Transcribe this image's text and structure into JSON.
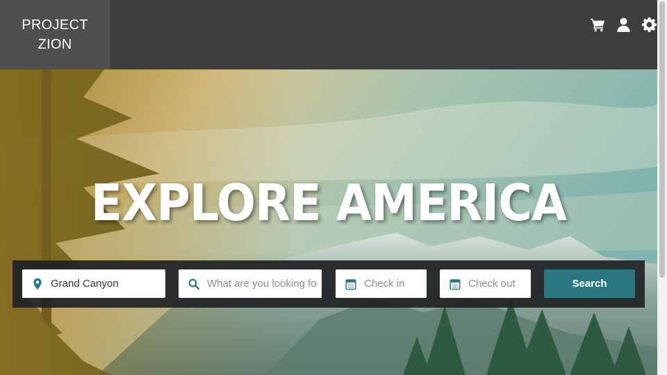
{
  "brand": {
    "line1": "PROJECT",
    "line2": "ZION"
  },
  "header_icons": [
    "cart-icon",
    "user-icon",
    "settings-icon"
  ],
  "hero": {
    "headline": "EXPLORE AMERICA"
  },
  "search": {
    "location_value": "Grand Canyon",
    "query_placeholder": "What are you looking for?",
    "checkin_placeholder": "Check in",
    "checkout_placeholder": "Check out",
    "button_label": "Search"
  },
  "colors": {
    "header": "#3e3e40",
    "logo_block": "#4f4f52",
    "accent": "#2a7780",
    "icon_teal": "#2a7780"
  }
}
